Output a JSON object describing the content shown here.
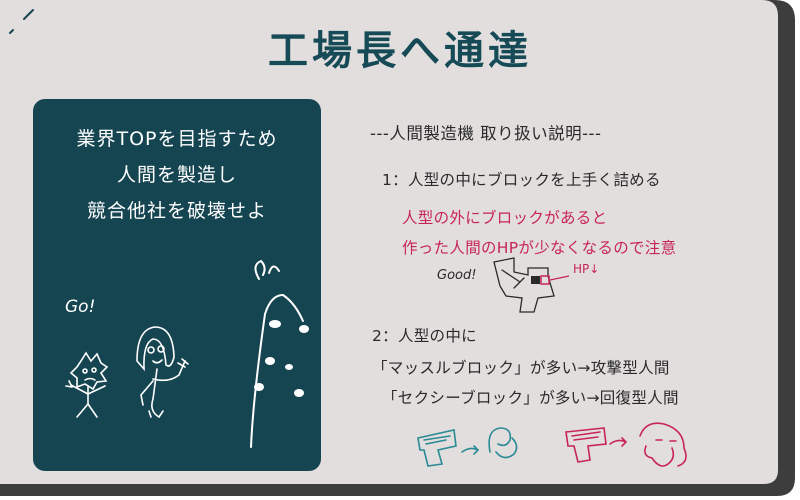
{
  "title": "工場長へ通達",
  "panel": {
    "lines": [
      "業界TOPを目指すため",
      "人間を製造し",
      "競合他社を破壊せよ"
    ],
    "go_label": "Go!"
  },
  "instructions": {
    "heading": "---人間製造機 取り扱い説明---",
    "item1": "1：人型の中にブロックを上手く詰める",
    "warning1": "人型の外にブロックがあると",
    "warning2": "作った人間のHPが少なくなるので注意",
    "sketch_good": "Good!",
    "sketch_hp": "HP↓",
    "item2": "2：人型の中に",
    "item2a": "「マッスルブロック」が多い→攻撃型人間",
    "item2b": "「セクシーブロック」が多い→回復型人間"
  },
  "colors": {
    "card": "#e1dedd",
    "card_shadow": "#3d3d3d",
    "panel": "#164552",
    "title": "#164a57",
    "accent_red": "#c8245a",
    "accent_teal": "#2a8a96"
  }
}
